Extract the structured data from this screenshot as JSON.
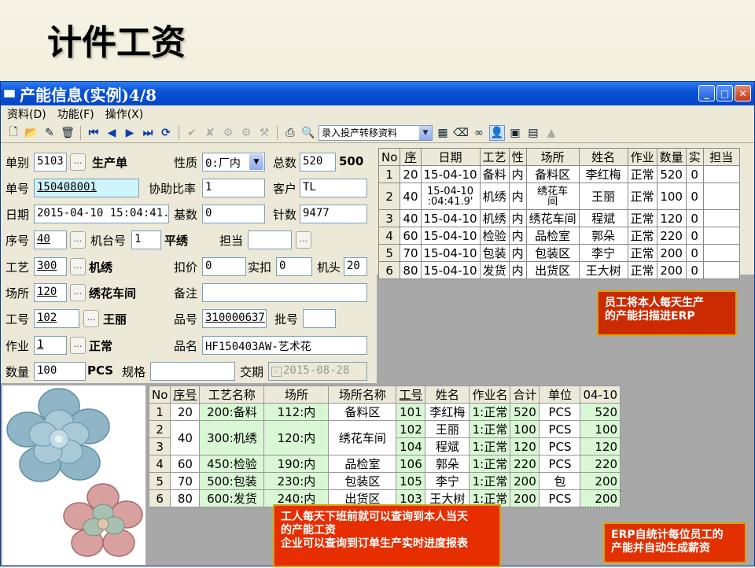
{
  "slide_title": "计件工资",
  "window": {
    "title": "产能信息(实例)4/8",
    "menu": [
      "资料(D)",
      "功能(F)",
      "操作(X)"
    ],
    "toolbar_select": "录入投产转移资料"
  },
  "form": {
    "danbie_label": "单别",
    "danbie_value": "5103",
    "danbie_name": "生产单",
    "xingzhi_label": "性质",
    "xingzhi_value": "0:厂内",
    "zongshu_label": "总数",
    "zongshu_value": "520",
    "zongshu_bold": "500",
    "danhao_label": "单号",
    "danhao_value": "150408001",
    "xiezhu_label": "协助比率",
    "xiezhu_value": "1",
    "kehu_label": "客户",
    "kehu_value": "TL",
    "riqi_label": "日期",
    "riqi_value": "2015-04-10 15:04:41.",
    "jishu_label": "基数",
    "jishu_value": "0",
    "zhenshu_label": "针数",
    "zhenshu_value": "9477",
    "xuhao_label": "序号",
    "xuhao_value": "40",
    "jitai_label": "机台号",
    "jitai_value": "1",
    "jitai_name": "平绣",
    "dandang_label": "担当",
    "gongyi_label": "工艺",
    "gongyi_value": "300",
    "gongyi_name": "机绣",
    "koujia_label": "扣价",
    "koujia_value": "0",
    "shikou_label": "实扣",
    "shikou_value": "0",
    "jitou_label": "机头",
    "jitou_value": "20",
    "changsuo_label": "场所",
    "changsuo_value": "120",
    "changsuo_name": "绣花车间",
    "beizhu_label": "备注",
    "gonghao_label": "工号",
    "gonghao_value": "102",
    "gonghao_name": "王丽",
    "pinhao_label": "品号",
    "pinhao_value": "310000637",
    "pihao_label": "批号",
    "zuoye_label": "作业",
    "zuoye_value": "1",
    "zuoye_name": "正常",
    "pinming_label": "品名",
    "pinming_value": "HF150403AW-艺术花",
    "shuliang_label": "数量",
    "shuliang_value": "100",
    "shuliang_unit": "PCS",
    "guige_label": "规格",
    "jiaoqi_label": "交期",
    "jiaoqi_value": "2015-08-28"
  },
  "grid1": {
    "headers": [
      "No",
      "序",
      "日期",
      "工艺",
      "性",
      "场所",
      "姓名",
      "作业",
      "数量",
      "实",
      "担当"
    ],
    "rows": [
      {
        "no": "1",
        "xu": "20",
        "date": "15-04-10",
        "date2": "",
        "gongyi": "备料",
        "xing": "内",
        "place": "备料区",
        "place2": "",
        "name": "李红梅",
        "job": "正常",
        "qty": "520",
        "shi": "0",
        "dd": ""
      },
      {
        "no": "2",
        "xu": "40",
        "date": "15-04-10",
        "date2": ":04:41.9'",
        "gongyi": "机绣",
        "xing": "内",
        "place": "绣花车",
        "place2": "间",
        "name": "王丽",
        "job": "正常",
        "qty": "100",
        "shi": "0",
        "dd": ""
      },
      {
        "no": "3",
        "xu": "40",
        "date": "15-04-10",
        "date2": "",
        "gongyi": "机绣",
        "xing": "内",
        "place": "绣花车间",
        "place2": "",
        "name": "程斌",
        "job": "正常",
        "qty": "120",
        "shi": "0",
        "dd": ""
      },
      {
        "no": "4",
        "xu": "60",
        "date": "15-04-10",
        "date2": "",
        "gongyi": "检验",
        "xing": "内",
        "place": "品检室",
        "place2": "",
        "name": "郭朵",
        "job": "正常",
        "qty": "220",
        "shi": "0",
        "dd": ""
      },
      {
        "no": "5",
        "xu": "70",
        "date": "15-04-10",
        "date2": "",
        "gongyi": "包装",
        "xing": "内",
        "place": "包装区",
        "place2": "",
        "name": "李宁",
        "job": "正常",
        "qty": "200",
        "shi": "0",
        "dd": ""
      },
      {
        "no": "6",
        "xu": "80",
        "date": "15-04-10",
        "date2": "",
        "gongyi": "发货",
        "xing": "内",
        "place": "出货区",
        "place2": "",
        "name": "王大树",
        "job": "正常",
        "qty": "200",
        "shi": "0",
        "dd": ""
      }
    ]
  },
  "grid2": {
    "headers": [
      "No",
      "序号",
      "工艺名称",
      "场所",
      "场所名称",
      "工号",
      "姓名",
      "作业名",
      "合计",
      "单位",
      "04-10"
    ],
    "rows": [
      {
        "no": "1",
        "xu": "20",
        "gy": "200:备料",
        "cs": "112:内",
        "csm": "备料区",
        "gh": "101",
        "xm": "李红梅",
        "zy": "1:正常",
        "hj": "520",
        "dw": "PCS",
        "d": "520"
      },
      {
        "no": "2",
        "xu": "40",
        "gy": "300:机绣",
        "cs": "120:内",
        "csm": "绣花车间",
        "gh": "102",
        "xm": "王丽",
        "zy": "1:正常",
        "hj": "100",
        "dw": "PCS",
        "d": "100"
      },
      {
        "no": "3",
        "xu": "",
        "gy": "",
        "cs": "",
        "csm": "",
        "gh": "104",
        "xm": "程斌",
        "zy": "1:正常",
        "hj": "120",
        "dw": "PCS",
        "d": "120"
      },
      {
        "no": "4",
        "xu": "60",
        "gy": "450:检验",
        "cs": "190:内",
        "csm": "品检室",
        "gh": "106",
        "xm": "郭朵",
        "zy": "1:正常",
        "hj": "220",
        "dw": "PCS",
        "d": "220"
      },
      {
        "no": "5",
        "xu": "70",
        "gy": "500:包装",
        "cs": "230:内",
        "csm": "包装区",
        "gh": "105",
        "xm": "李宁",
        "zy": "1:正常",
        "hj": "200",
        "dw": "包",
        "d": "200"
      },
      {
        "no": "6",
        "xu": "80",
        "gy": "600:发货",
        "cs": "240:内",
        "csm": "出货区",
        "gh": "103",
        "xm": "王大树",
        "zy": "1:正常",
        "hj": "200",
        "dw": "PCS",
        "d": "200"
      }
    ]
  },
  "callouts": {
    "c1": [
      "员工将本人每天生产",
      "的产能扫描进ERP"
    ],
    "c2": [
      "工人每天下班前就可以查询到本人当天",
      "的产能工资",
      "企业可以查询到订单生产实时进度报表"
    ],
    "c3": [
      "ERP自统计每位员工的",
      "产能并自动生成薪资"
    ]
  },
  "colors": {
    "callout_bg": "#e62e00",
    "titlebar": "#0a52d6",
    "grid_green": "#d9f7d5",
    "highlight_input": "#cdf3fb"
  }
}
